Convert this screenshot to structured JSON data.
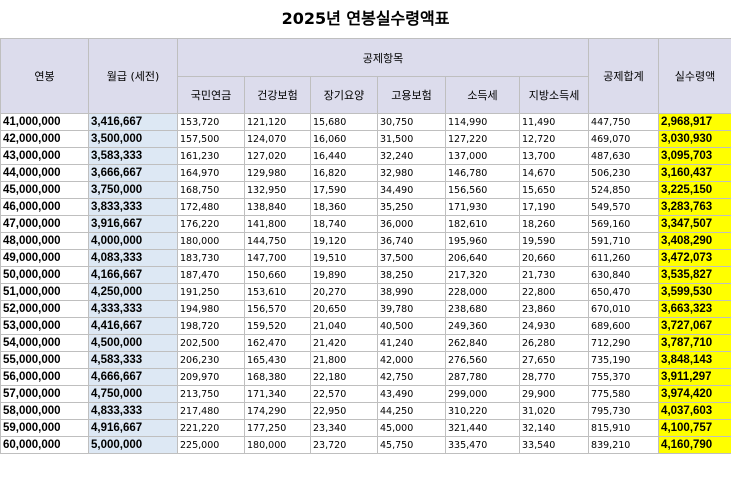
{
  "title": "2025년 연봉실수령액표",
  "headers": {
    "annual": "연봉",
    "monthly": "월급 (세전)",
    "deductions_group": "공제항목",
    "pension": "국민연금",
    "health": "건강보험",
    "longterm_care": "장기요양",
    "employment": "고용보험",
    "income_tax": "소득세",
    "local_tax": "지방소득세",
    "total_deduction": "공제합계",
    "net_pay": "실수령액"
  },
  "rows": [
    [
      "41,000,000",
      "3,416,667",
      "153,720",
      "121,120",
      "15,680",
      "30,750",
      "114,990",
      "11,490",
      "447,750",
      "2,968,917"
    ],
    [
      "42,000,000",
      "3,500,000",
      "157,500",
      "124,070",
      "16,060",
      "31,500",
      "127,220",
      "12,720",
      "469,070",
      "3,030,930"
    ],
    [
      "43,000,000",
      "3,583,333",
      "161,230",
      "127,020",
      "16,440",
      "32,240",
      "137,000",
      "13,700",
      "487,630",
      "3,095,703"
    ],
    [
      "44,000,000",
      "3,666,667",
      "164,970",
      "129,980",
      "16,820",
      "32,980",
      "146,780",
      "14,670",
      "506,230",
      "3,160,437"
    ],
    [
      "45,000,000",
      "3,750,000",
      "168,750",
      "132,950",
      "17,590",
      "34,490",
      "156,560",
      "15,650",
      "524,850",
      "3,225,150"
    ],
    [
      "46,000,000",
      "3,833,333",
      "172,480",
      "138,840",
      "18,360",
      "35,250",
      "171,930",
      "17,190",
      "549,570",
      "3,283,763"
    ],
    [
      "47,000,000",
      "3,916,667",
      "176,220",
      "141,800",
      "18,740",
      "36,000",
      "182,610",
      "18,260",
      "569,160",
      "3,347,507"
    ],
    [
      "48,000,000",
      "4,000,000",
      "180,000",
      "144,750",
      "19,120",
      "36,740",
      "195,960",
      "19,590",
      "591,710",
      "3,408,290"
    ],
    [
      "49,000,000",
      "4,083,333",
      "183,730",
      "147,700",
      "19,510",
      "37,500",
      "206,640",
      "20,660",
      "611,260",
      "3,472,073"
    ],
    [
      "50,000,000",
      "4,166,667",
      "187,470",
      "150,660",
      "19,890",
      "38,250",
      "217,320",
      "21,730",
      "630,840",
      "3,535,827"
    ],
    [
      "51,000,000",
      "4,250,000",
      "191,250",
      "153,610",
      "20,270",
      "38,990",
      "228,000",
      "22,800",
      "650,470",
      "3,599,530"
    ],
    [
      "52,000,000",
      "4,333,333",
      "194,980",
      "156,570",
      "20,650",
      "39,780",
      "238,680",
      "23,860",
      "670,010",
      "3,663,323"
    ],
    [
      "53,000,000",
      "4,416,667",
      "198,720",
      "159,520",
      "21,040",
      "40,500",
      "249,360",
      "24,930",
      "689,600",
      "3,727,067"
    ],
    [
      "54,000,000",
      "4,500,000",
      "202,500",
      "162,470",
      "21,420",
      "41,240",
      "262,840",
      "26,280",
      "712,290",
      "3,787,710"
    ],
    [
      "55,000,000",
      "4,583,333",
      "206,230",
      "165,430",
      "21,800",
      "42,000",
      "276,560",
      "27,650",
      "735,190",
      "3,848,143"
    ],
    [
      "56,000,000",
      "4,666,667",
      "209,970",
      "168,380",
      "22,180",
      "42,750",
      "287,780",
      "28,770",
      "755,370",
      "3,911,297"
    ],
    [
      "57,000,000",
      "4,750,000",
      "213,750",
      "171,340",
      "22,570",
      "43,490",
      "299,000",
      "29,900",
      "775,580",
      "3,974,420"
    ],
    [
      "58,000,000",
      "4,833,333",
      "217,480",
      "174,290",
      "22,950",
      "44,250",
      "310,220",
      "31,020",
      "795,730",
      "4,037,603"
    ],
    [
      "59,000,000",
      "4,916,667",
      "221,220",
      "177,250",
      "23,340",
      "45,000",
      "321,440",
      "32,140",
      "815,910",
      "4,100,757"
    ],
    [
      "60,000,000",
      "5,000,000",
      "225,000",
      "180,000",
      "23,720",
      "45,750",
      "335,470",
      "33,540",
      "839,210",
      "4,160,790"
    ]
  ],
  "colors": {
    "header_bg": "#dcdcec",
    "monthly_bg": "#dde8f4",
    "net_bg": "#ffff00"
  }
}
